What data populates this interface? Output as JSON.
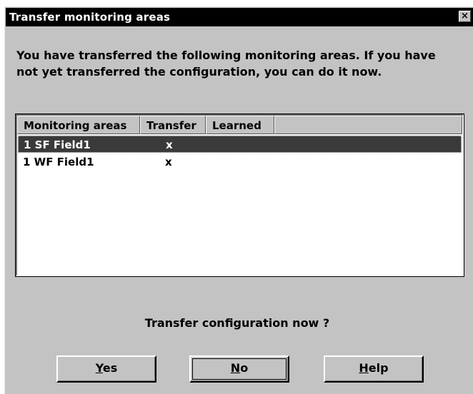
{
  "window": {
    "title": "Transfer monitoring areas",
    "close_glyph": "×"
  },
  "message": "You have transferred the following monitoring areas. If you have not yet transferred the configuration, you can do it now.",
  "list": {
    "columns": [
      "Monitoring areas",
      "Transfer",
      "Learned"
    ],
    "rows": [
      {
        "name": "1 SF Field1",
        "transfer": "x",
        "learned": "",
        "selected": true
      },
      {
        "name": "1 WF Field1",
        "transfer": "x",
        "learned": "",
        "selected": false
      }
    ]
  },
  "question": "Transfer configuration now ?",
  "buttons": {
    "yes": {
      "mnemonic": "Y",
      "rest": "es"
    },
    "no": {
      "mnemonic": "N",
      "rest": "o"
    },
    "help": {
      "mnemonic": "H",
      "rest": "elp"
    }
  },
  "colors": {
    "title_bar": "#000000",
    "window_bg": "#c3c3c3",
    "selection": "#3a3a3a"
  }
}
